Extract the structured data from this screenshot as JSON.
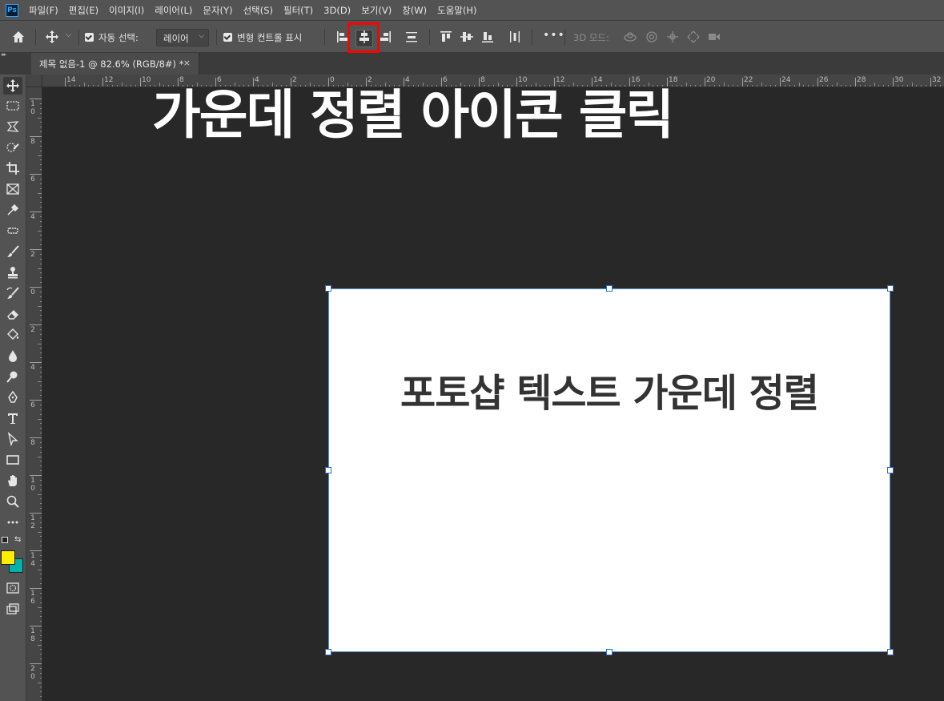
{
  "app": {
    "logo_text": "Ps"
  },
  "menu": [
    "파일(F)",
    "편집(E)",
    "이미지(I)",
    "레이어(L)",
    "문자(Y)",
    "선택(S)",
    "필터(T)",
    "3D(D)",
    "보기(V)",
    "창(W)",
    "도움말(H)"
  ],
  "options": {
    "auto_select_label": "자동 선택:",
    "auto_select_value": "레이어",
    "show_transform_label": "변형 컨트롤 표시",
    "mode_3d_label": "3D 모드:",
    "more_label": "•••",
    "highlighted_button": "align-horizontal-centers-icon",
    "highlight_color": "#ff0000"
  },
  "tab": {
    "title": "제목 없음-1 @ 82.6% (RGB/8#) *",
    "close": "×"
  },
  "ruler": {
    "horizontal": [
      "14",
      "12",
      "10",
      "8",
      "6",
      "4",
      "2",
      "0",
      "2",
      "4",
      "6",
      "8",
      "10",
      "12",
      "14",
      "16",
      "18",
      "20",
      "22",
      "24",
      "26",
      "28",
      "30",
      "32"
    ],
    "vertical": [
      "10",
      "8",
      "6",
      "4",
      "2",
      "0",
      "2",
      "4",
      "6",
      "8",
      "10",
      "12",
      "14",
      "16",
      "18",
      "20"
    ]
  },
  "overlay_caption": "가운데 정렬 아이콘 클릭",
  "document": {
    "text": "포토샵 텍스트 가운데 정렬"
  },
  "colors": {
    "foreground": "#ffed00",
    "background": "#00b3ad",
    "selection": "#2b6ed1"
  }
}
